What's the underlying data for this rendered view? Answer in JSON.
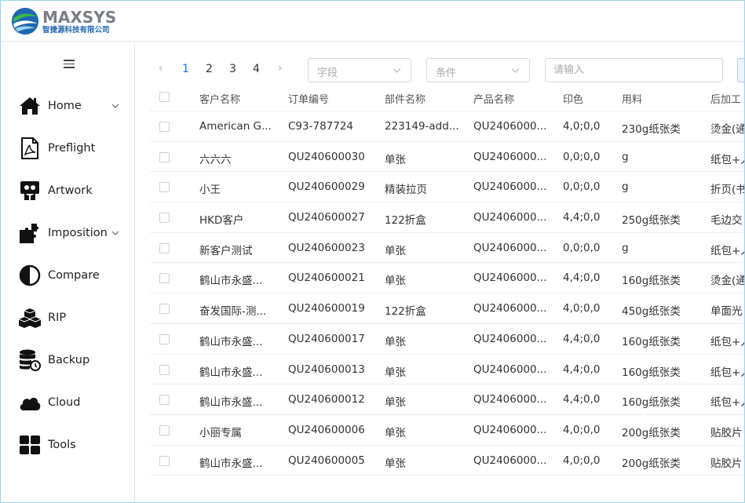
{
  "brand": {
    "name": "MAXSYS",
    "subtitle": "智捷源科技有限公司"
  },
  "colors": {
    "accent": "#1677ff",
    "logo_blue": "#1e67b3",
    "logo_green": "#3cb54a",
    "border": "#e6e6e6"
  },
  "sidebar": {
    "menu_icon": "hamburger-icon",
    "items": [
      {
        "label": "Home",
        "icon": "home-icon",
        "has_submenu": true
      },
      {
        "label": "Preflight",
        "icon": "pdf-icon",
        "has_submenu": false
      },
      {
        "label": "Artwork",
        "icon": "artwork-icon",
        "has_submenu": false
      },
      {
        "label": "Imposition",
        "icon": "puzzle-icon",
        "has_submenu": true
      },
      {
        "label": "Compare",
        "icon": "contrast-icon",
        "has_submenu": false
      },
      {
        "label": "RIP",
        "icon": "cubes-icon",
        "has_submenu": false
      },
      {
        "label": "Backup",
        "icon": "database-icon",
        "has_submenu": false
      },
      {
        "label": "Cloud",
        "icon": "cloud-icon",
        "has_submenu": false
      },
      {
        "label": "Tools",
        "icon": "grid-icon",
        "has_submenu": false
      }
    ]
  },
  "toolbar": {
    "prev": "‹",
    "next": "›",
    "pages": [
      "1",
      "2",
      "3",
      "4"
    ],
    "current_page": "1",
    "field_select_placeholder": "字段",
    "condition_select_placeholder": "条件",
    "search_placeholder": "请输入"
  },
  "table": {
    "columns": [
      "客户名称",
      "订单编号",
      "部件名称",
      "产品名称",
      "印色",
      "用料",
      "后加工"
    ],
    "rows": [
      [
        "American G...",
        "C93-787724",
        "223149-add...",
        "QU2406000...",
        "4,0;0,0",
        "230g纸张类",
        "烫金(通"
      ],
      [
        "六六六",
        "QU240600030",
        "单张",
        "QU2406000...",
        "0,0;0,0",
        "g",
        "纸包+人"
      ],
      [
        "小王",
        "QU240600029",
        "精装拉页",
        "QU2406000...",
        "0,0;0,0",
        "g",
        "折页(书"
      ],
      [
        "HKD客户",
        "QU240600027",
        "122折盒",
        "QU2406000...",
        "4,4;0,0",
        "250g纸张类",
        "毛边交"
      ],
      [
        "新客户测试",
        "QU240600023",
        "单张",
        "QU2406000...",
        "0,0;0,0",
        "g",
        "纸包+人"
      ],
      [
        "鹤山市永盛...",
        "QU240600021",
        "单张",
        "QU2406000...",
        "4,4;0,0",
        "160g纸张类",
        "烫金(通"
      ],
      [
        "奋发国际-测...",
        "QU240600019",
        "122折盒",
        "QU2406000...",
        "4,0;0,0",
        "450g纸张类",
        "单面光"
      ],
      [
        "鹤山市永盛...",
        "QU240600017",
        "单张",
        "QU2406000...",
        "4,4;0,0",
        "160g纸张类",
        "纸包+人"
      ],
      [
        "鹤山市永盛...",
        "QU240600013",
        "单张",
        "QU2406000...",
        "4,4;0,0",
        "160g纸张类",
        "纸包+人"
      ],
      [
        "鹤山市永盛...",
        "QU240600012",
        "单张",
        "QU2406000...",
        "4,4;0,0",
        "160g纸张类",
        "纸包+人"
      ],
      [
        "小丽专属",
        "QU240600006",
        "单张",
        "QU2406000...",
        "4,0;0,0",
        "200g纸张类",
        "贴胶片"
      ],
      [
        "鹤山市永盛...",
        "QU240600005",
        "单张",
        "QU2406000...",
        "4,0;0,0",
        "200g纸张类",
        "贴胶片"
      ]
    ]
  }
}
